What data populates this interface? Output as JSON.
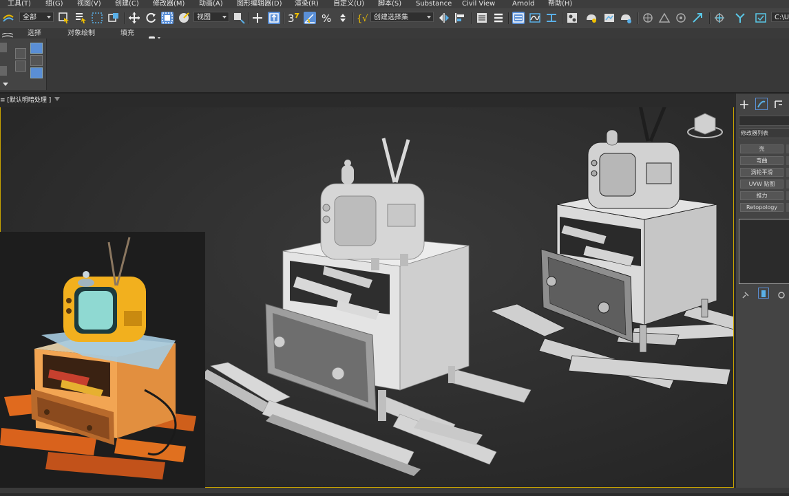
{
  "menu": {
    "items": [
      "工具(T)",
      "组(G)",
      "视图(V)",
      "创建(C)",
      "修改器(M)",
      "动画(A)",
      "图形编辑器(D)",
      "渲染(R)",
      "自定义(U)",
      "脚本(S)",
      "Substance",
      "Civil View",
      "Arnold",
      "帮助(H)"
    ]
  },
  "toolbar": {
    "selection_filter": "全部",
    "reference_coord": "视图",
    "named_selection": "创建选择集",
    "path_text": "C:\\Us"
  },
  "ribbon": {
    "tabs": [
      "选择",
      "对象绘制",
      "填充"
    ]
  },
  "viewport": {
    "label": "[ + ] [默认明暗处理 ]",
    "label_visible": "≡ [默认明暗处理 ]"
  },
  "command_panel": {
    "modifier_list": "修改器列表",
    "buttons": [
      "壳",
      "弯曲",
      "涡轮平滑",
      "UVW 贴图",
      "推力",
      "Retopology"
    ]
  },
  "colors": {
    "viewport_border": "#c9a400",
    "selection_highlight": "#5a8fd6",
    "tv_reference_yellow": "#f2b01e",
    "floor_reference_orange": "#d9621c"
  }
}
